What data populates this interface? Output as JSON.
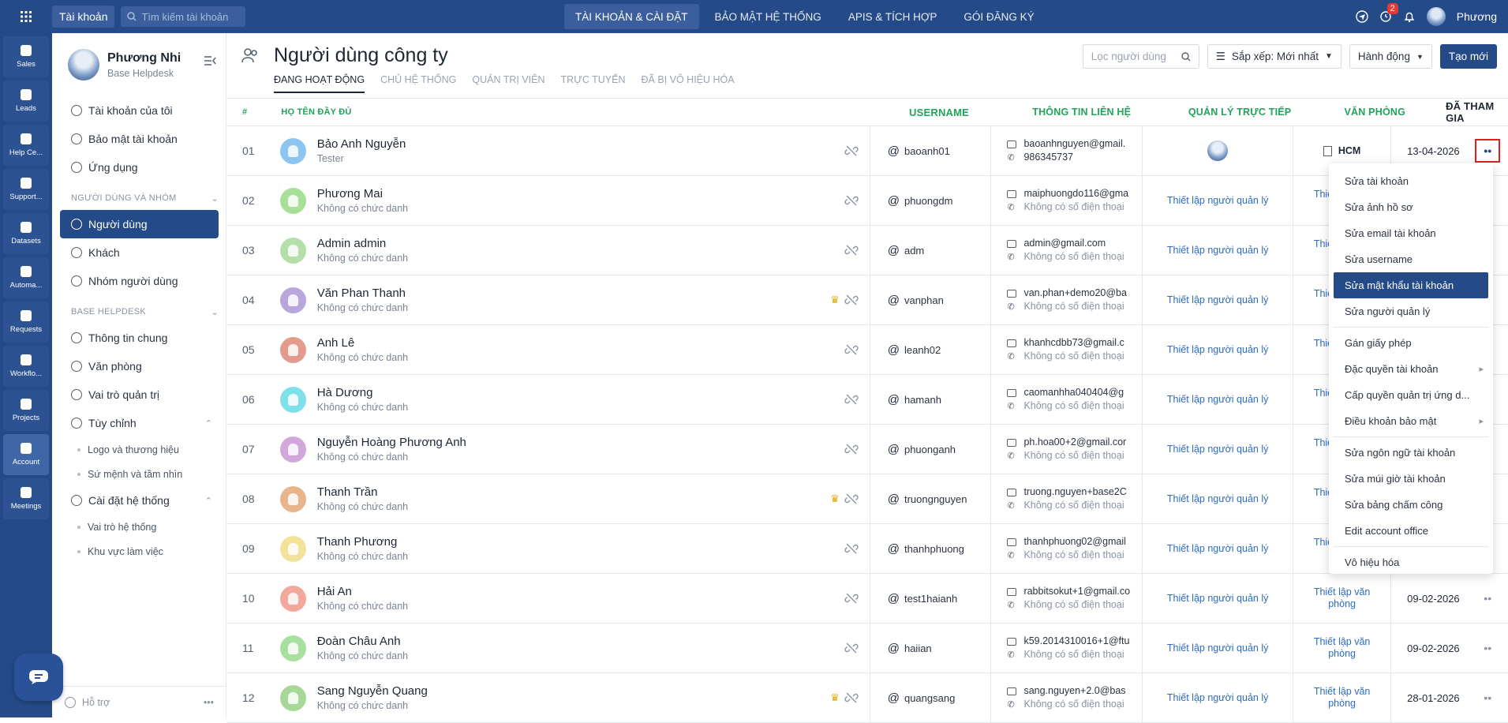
{
  "topbar": {
    "account_label": "Tài khoản",
    "search_placeholder": "Tìm kiếm tài khoản",
    "nav": [
      "TÀI KHOẢN & CÀI ĐẶT",
      "BẢO MẬT HỆ THỐNG",
      "APIS & TÍCH HỢP",
      "GÓI ĐĂNG KÝ"
    ],
    "alarm_badge": "2",
    "user_name": "Phương"
  },
  "rail": [
    "Sales",
    "Leads",
    "Help Ce...",
    "Support...",
    "Datasets",
    "Automa...",
    "Requests",
    "Workflo...",
    "Projects",
    "Account",
    "Meetings"
  ],
  "sidebar": {
    "name": "Phương Nhi",
    "org": "Base Helpdesk",
    "items_top": [
      "Tài khoản của tôi",
      "Bảo mật tài khoản",
      "Ứng dụng"
    ],
    "section_users": "NGƯỜI DÙNG VÀ NHÓM",
    "items_users": [
      "Người dùng",
      "Khách",
      "Nhóm người dùng"
    ],
    "section_base": "BASE HELPDESK",
    "items_base": [
      "Thông tin chung",
      "Văn phòng",
      "Vai trò quản trị",
      "Tùy chỉnh"
    ],
    "sub_custom": [
      "Logo và thương hiệu",
      "Sứ mệnh và tầm nhìn"
    ],
    "item_system": "Cài đặt hệ thống",
    "sub_system": [
      "Vai trò hệ thống",
      "Khu vực làm việc"
    ],
    "footer": "Hỗ trợ"
  },
  "page": {
    "title": "Người dùng công ty",
    "tabs": [
      "ĐANG HOẠT ĐỘNG",
      "CHỦ HỆ THỐNG",
      "QUẢN TRỊ VIÊN",
      "TRỰC TUYẾN",
      "ĐÃ BỊ VÔ HIỆU HÓA"
    ],
    "filter_placeholder": "Lọc người dùng",
    "sort_label": "Sắp xếp: Mới nhất",
    "action_label": "Hành động",
    "create_label": "Tạo mới"
  },
  "table": {
    "headers": [
      "#",
      "HỌ TÊN ĐẦY ĐỦ",
      "USERNAME",
      "THÔNG TIN LIÊN HỆ",
      "QUẢN LÝ TRỰC TIẾP",
      "VĂN PHÒNG",
      "ĐÃ THAM GIA"
    ],
    "rows": [
      {
        "no": "01",
        "name": "Bảo Anh Nguyễn",
        "title": "Tester",
        "username": "baoanh01",
        "email": "baoanhnguyen@gmail.",
        "phone": "986345737",
        "manager": "",
        "office": "HCM",
        "joined": "13-04-2026",
        "crown": false,
        "color": "#8cc4f2"
      },
      {
        "no": "02",
        "name": "Phương Mai",
        "title": "Không có chức danh",
        "username": "phuongdm",
        "email": "maiphuongdo116@gma",
        "phone": "Không có số điện thoại",
        "manager": "Thiết lập người quản lý",
        "office": "Thiết lập văn phòng",
        "joined": "",
        "crown": false,
        "color": "#a8e09a"
      },
      {
        "no": "03",
        "name": "Admin admin",
        "title": "Không có chức danh",
        "username": "adm",
        "email": "admin@gmail.com",
        "phone": "Không có số điện thoại",
        "manager": "Thiết lập người quản lý",
        "office": "Thiết lập văn phòng",
        "joined": "",
        "crown": false,
        "color": "#b5dfa8"
      },
      {
        "no": "04",
        "name": "Văn Phan Thanh",
        "title": "Không có chức danh",
        "username": "vanphan",
        "email": "van.phan+demo20@ba",
        "phone": "Không có số điện thoại",
        "manager": "Thiết lập người quản lý",
        "office": "Thiết lập văn phòng",
        "joined": "",
        "crown": true,
        "color": "#b9a6dc"
      },
      {
        "no": "05",
        "name": "Anh Lê",
        "title": "Không có chức danh",
        "username": "leanh02",
        "email": "khanhcdbb73@gmail.c",
        "phone": "Không có số điện thoại",
        "manager": "Thiết lập người quản lý",
        "office": "Thiết lập văn phòng",
        "joined": "",
        "crown": false,
        "color": "#e49a8c"
      },
      {
        "no": "06",
        "name": "Hà Dương",
        "title": "Không có chức danh",
        "username": "hamanh",
        "email": "caomanhha040404@g",
        "phone": "Không có số điện thoại",
        "manager": "Thiết lập người quản lý",
        "office": "Thiết lập văn phòng",
        "joined": "",
        "crown": false,
        "color": "#7fe0ea"
      },
      {
        "no": "07",
        "name": "Nguyễn Hoàng Phương Anh",
        "title": "Không có chức danh",
        "username": "phuonganh",
        "email": "ph.hoa00+2@gmail.cor",
        "phone": "Không có số điện thoại",
        "manager": "Thiết lập người quản lý",
        "office": "Thiết lập văn phòng",
        "joined": "",
        "crown": false,
        "color": "#d2a8dc"
      },
      {
        "no": "08",
        "name": "Thanh Trần",
        "title": "Không có chức danh",
        "username": "truongnguyen",
        "email": "truong.nguyen+base2C",
        "phone": "Không có số điện thoại",
        "manager": "Thiết lập người quản lý",
        "office": "Thiết lập văn phòng",
        "joined": "",
        "crown": true,
        "color": "#e8b48c"
      },
      {
        "no": "09",
        "name": "Thanh Phương",
        "title": "Không có chức danh",
        "username": "thanhphuong",
        "email": "thanhphuong02@gmail",
        "phone": "Không có số điện thoại",
        "manager": "Thiết lập người quản lý",
        "office": "Thiết lập văn phòng",
        "joined": "",
        "crown": false,
        "color": "#f2e29a"
      },
      {
        "no": "10",
        "name": "Hải An",
        "title": "Không có chức danh",
        "username": "test1haianh",
        "email": "rabbitsokut+1@gmail.co",
        "phone": "Không có số điện thoại",
        "manager": "Thiết lập người quản lý",
        "office": "Thiết lập văn phòng",
        "joined": "09-02-2026",
        "crown": false,
        "color": "#f2a89a"
      },
      {
        "no": "11",
        "name": "Đoàn Châu Anh",
        "title": "Không có chức danh",
        "username": "haiian",
        "email": "k59.2014310016+1@ftu",
        "phone": "Không có số điện thoại",
        "manager": "Thiết lập người quản lý",
        "office": "Thiết lập văn phòng",
        "joined": "09-02-2026",
        "crown": false,
        "color": "#a8e0a0"
      },
      {
        "no": "12",
        "name": "Sang Nguyễn Quang",
        "title": "Không có chức danh",
        "username": "quangsang",
        "email": "sang.nguyen+2.0@bas",
        "phone": "Không có số điện thoại",
        "manager": "Thiết lập người quản lý",
        "office": "Thiết lập văn phòng",
        "joined": "28-01-2026",
        "crown": true,
        "color": "#a8d898"
      }
    ]
  },
  "dropdown": {
    "group1": [
      "Sửa tài khoản",
      "Sửa ảnh hồ sơ",
      "Sửa email tài khoản",
      "Sửa username",
      "Sửa mật khẩu tài khoản",
      "Sửa người quản lý"
    ],
    "group2": [
      "Gán giấy phép",
      "Đặc quyền tài khoản",
      "Cấp quyền quản trị ứng d...",
      "Điều khoản bảo mật"
    ],
    "group3": [
      "Sửa ngôn ngữ tài khoản",
      "Sửa múi giờ tài khoản",
      "Sửa bảng chấm công",
      "Edit account office"
    ],
    "group4": [
      "Vô hiệu hóa"
    ],
    "active_item": "Sửa mật khẩu tài khoản"
  },
  "colors": {
    "brand": "#244a88",
    "header_green": "#22a35b",
    "link": "#2b6cc4"
  }
}
